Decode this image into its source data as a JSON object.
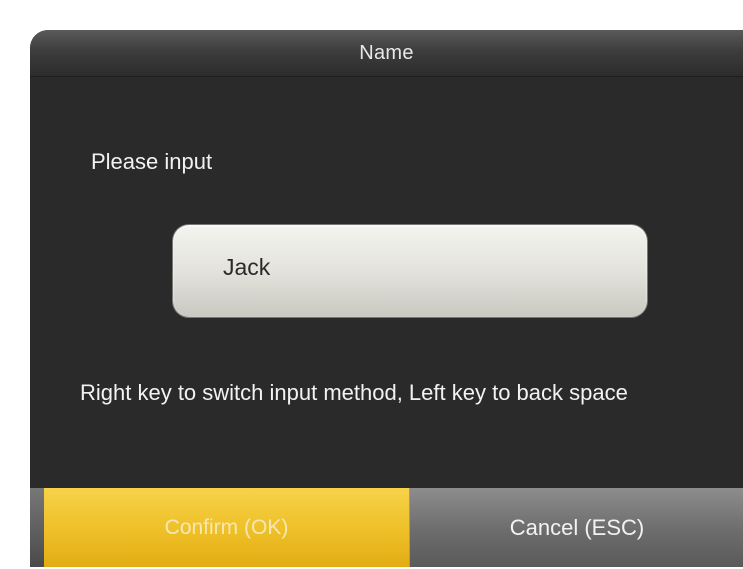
{
  "dialog": {
    "title": "Name",
    "prompt": "Please input",
    "input_value": "Jack",
    "hint": "Right key to switch input method, Left key to back space"
  },
  "buttons": {
    "confirm_label": "Confirm (OK)",
    "cancel_label": "Cancel (ESC)"
  },
  "colors": {
    "background": "#2a2a2a",
    "confirm": "#efc12a",
    "cancel": "#6c6c6c"
  }
}
